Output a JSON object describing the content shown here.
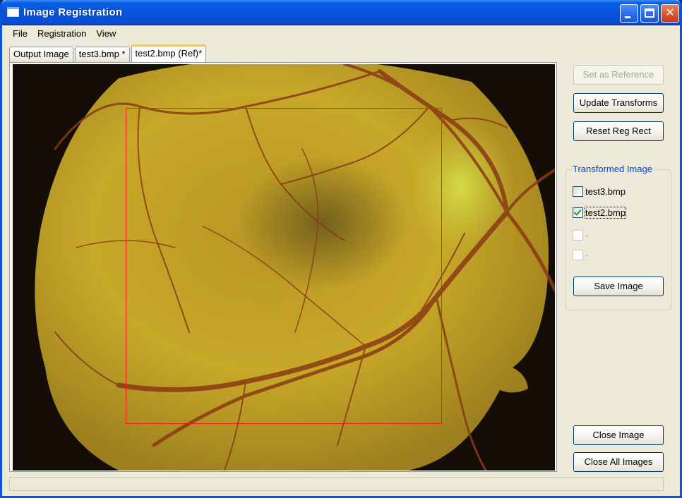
{
  "window": {
    "title": "Image Registration"
  },
  "menu": [
    "File",
    "Registration",
    "View"
  ],
  "tabs": [
    {
      "label": "Output Image",
      "active": false
    },
    {
      "label": "test3.bmp *",
      "active": false
    },
    {
      "label": "test2.bmp (Ref)*",
      "active": true
    }
  ],
  "buttons": {
    "set_reference": "Set as Reference",
    "update_transforms": "Update Transforms",
    "reset_reg_rect": "Reset Reg Rect",
    "save_image": "Save Image",
    "close_image": "Close Image",
    "close_all_images": "Close All Images"
  },
  "transformed": {
    "group_label": "Transformed Image",
    "items": [
      {
        "label": "test3.bmp",
        "checked": false,
        "enabled": true
      },
      {
        "label": "test2.bmp",
        "checked": true,
        "enabled": true
      },
      {
        "label": "-",
        "checked": false,
        "enabled": false
      },
      {
        "label": "-",
        "checked": false,
        "enabled": false
      }
    ]
  },
  "colors": {
    "title_bar": "#0553dc",
    "registration_rect": "#ff1a1a",
    "fundus_yellow": "#c9a925"
  }
}
